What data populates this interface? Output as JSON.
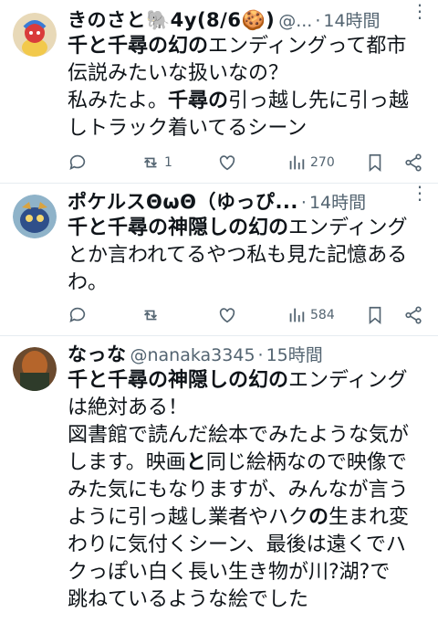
{
  "tweets": [
    {
      "name": "きのさと🐘4y(8/6🍪)",
      "handle": "@...",
      "separator": "·",
      "time": "14時間",
      "more": "⋮",
      "lines": [
        [
          {
            "t": "千と千尋の幻の",
            "b": true
          },
          {
            "t": "エンディングって都市",
            "b": false
          }
        ],
        [
          {
            "t": "伝説みたいな扱いなの？",
            "b": false
          }
        ],
        [
          {
            "t": "私みたよ。",
            "b": false
          },
          {
            "t": "千尋の",
            "b": true
          },
          {
            "t": "引っ越し先に引っ越",
            "b": false
          }
        ],
        [
          {
            "t": "しトラック着いてるシーン",
            "b": false
          }
        ]
      ],
      "actions": {
        "reply": "",
        "retweet": "1",
        "like": "",
        "views": "270"
      }
    },
    {
      "name": "ポケルスΘωΘ（ゆっぴ...",
      "handle": "",
      "separator": "·",
      "time": "14時間",
      "more": "⋮",
      "lines": [
        [
          {
            "t": "千と千尋の神隠しの幻の",
            "b": true
          },
          {
            "t": "エンディング",
            "b": false
          }
        ],
        [
          {
            "t": "とか言われてるやつ私も見た記憶ある",
            "b": false
          }
        ],
        [
          {
            "t": "わ。",
            "b": false
          }
        ]
      ],
      "actions": {
        "reply": "",
        "retweet": "",
        "like": "",
        "views": "584"
      }
    },
    {
      "name": "なっな",
      "handle": "@nanaka3345",
      "separator": "·",
      "time": "15時間",
      "more": "",
      "lines": [
        [
          {
            "t": "千と千尋の神隠しの幻の",
            "b": true
          },
          {
            "t": "エンディング",
            "b": false
          }
        ],
        [
          {
            "t": "は絶対ある！",
            "b": false
          }
        ],
        [
          {
            "t": "図書館で読んだ絵本でみたような気が",
            "b": false
          }
        ],
        [
          {
            "t": "します。映画",
            "b": false
          },
          {
            "t": "と",
            "b": true
          },
          {
            "t": "同じ絵柄なので映像で",
            "b": false
          }
        ],
        [
          {
            "t": "みた気にもなりますが、みんなが言う",
            "b": false
          }
        ],
        [
          {
            "t": "ように引っ越し業者やハク",
            "b": false
          },
          {
            "t": "の",
            "b": true
          },
          {
            "t": "生まれ変",
            "b": false
          }
        ],
        [
          {
            "t": "わりに気付くシーン、最後は遠くでハ",
            "b": false
          }
        ],
        [
          {
            "t": "クっぽい白く長い生き物が川?湖?で",
            "b": false
          }
        ],
        [
          {
            "t": "跳ねているような絵でした",
            "b": false
          }
        ]
      ],
      "actions": null
    }
  ]
}
